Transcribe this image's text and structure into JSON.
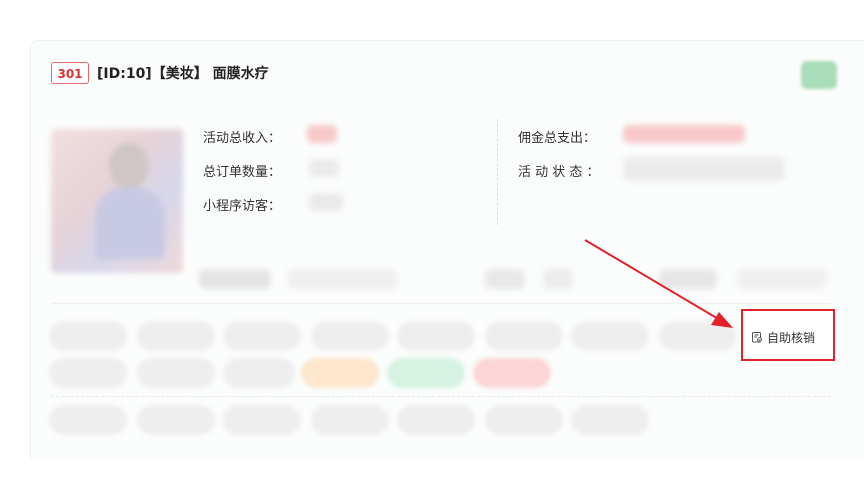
{
  "header": {
    "tag": "301",
    "title": "[ID:10]【美妆】 面膜水疗"
  },
  "stats": {
    "total_income_label": "活动总收入：",
    "total_orders_label": "总订单数量：",
    "mini_program_visitors_label": "小程序访客：",
    "commission_total_label": "佣金总支出：",
    "activity_status_label": "活 动 状 态 ："
  },
  "actions": {
    "self_verify_label": "自助核销"
  },
  "colors": {
    "callout_border": "#e3212a",
    "tag_red": "#d33333",
    "badge_green": "#a9dcb8"
  },
  "icons": {
    "self_verify": "clipboard-check-icon"
  }
}
